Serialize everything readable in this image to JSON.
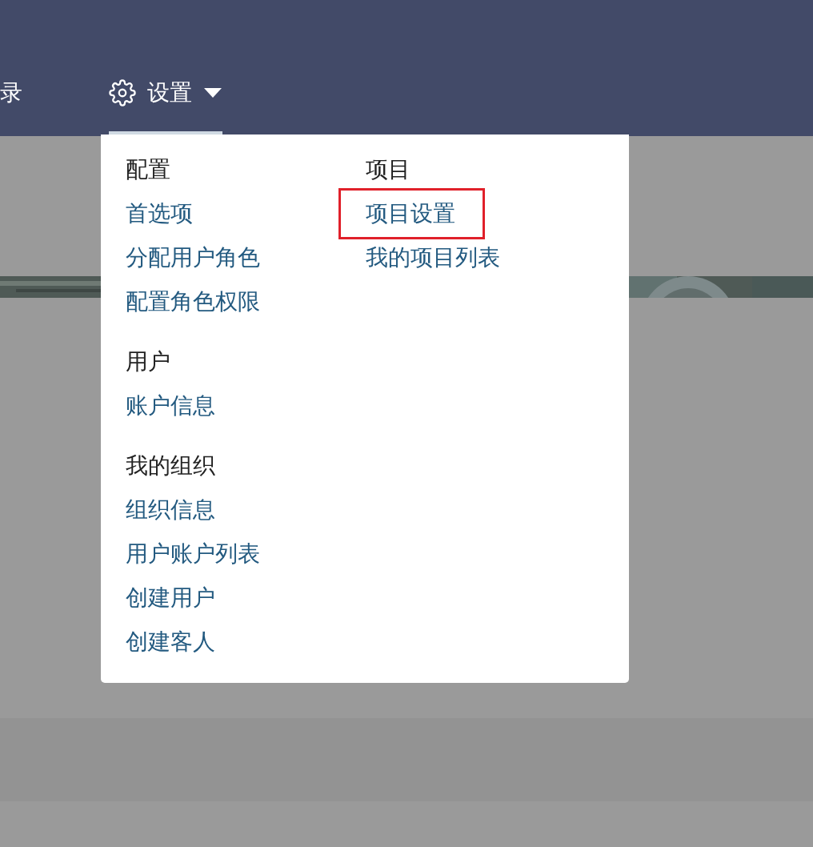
{
  "nav": [
    {
      "label": "录",
      "kind": "text",
      "open": false
    },
    {
      "label": "设置",
      "kind": "settings",
      "open": true
    }
  ],
  "menu": {
    "columns": [
      {
        "sections": [
          {
            "heading": "配置",
            "items": [
              {
                "label": "首选项",
                "highlighted": false
              },
              {
                "label": "分配用户角色",
                "highlighted": false
              },
              {
                "label": "配置角色权限",
                "highlighted": false
              }
            ]
          },
          {
            "heading": "用户",
            "items": [
              {
                "label": "账户信息",
                "highlighted": false
              }
            ]
          },
          {
            "heading": "我的组织",
            "items": [
              {
                "label": "组织信息",
                "highlighted": false
              },
              {
                "label": "用户账户列表",
                "highlighted": false
              },
              {
                "label": "创建用户",
                "highlighted": false
              },
              {
                "label": "创建客人",
                "highlighted": false
              }
            ]
          }
        ]
      },
      {
        "sections": [
          {
            "heading": "项目",
            "items": [
              {
                "label": "项目设置",
                "highlighted": true
              },
              {
                "label": "我的项目列表",
                "highlighted": false
              }
            ]
          }
        ]
      }
    ]
  }
}
